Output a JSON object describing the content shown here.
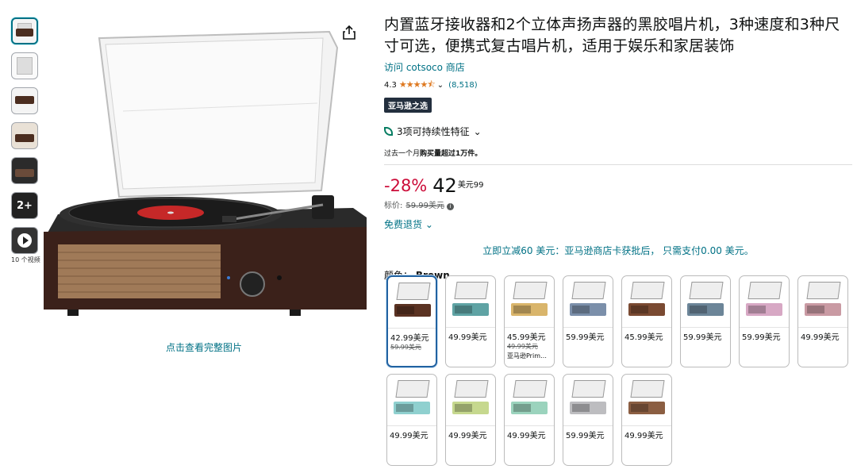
{
  "thumbnails": {
    "more_label": "2+",
    "video_label": "10 个视频"
  },
  "gallery": {
    "see_full_label": "点击查看完整图片"
  },
  "product": {
    "title": "内置蓝牙接收器和2个立体声扬声器的黑胶唱片机，3种速度和3种尺寸可选，便携式复古唱片机，适用于娱乐和家居装饰",
    "store_link": "访问 cotsoco 商店",
    "rating": "4.3",
    "stars": "★★★★⯪",
    "rating_count": "(8,518)",
    "badge": "亚马逊之选",
    "sustainability": "3项可持续性特征",
    "bought_prefix": "过去一个月",
    "bought_bold": "购买量超过1万件。"
  },
  "price": {
    "discount": "-28%",
    "whole": "42",
    "unit_fraction": "美元99",
    "list_label": "标价:",
    "list_price": "59.99美元",
    "returns": "免费退货",
    "promo": "立即立减60 美元：亚马逊商店卡获批后， 只需支付0.00 美元。"
  },
  "color": {
    "label": "颜色：",
    "selected": "Brown"
  },
  "swatches": [
    {
      "price": "42.99美元",
      "list": "59.99美元",
      "note": "",
      "body": "#5a3222"
    },
    {
      "price": "49.99美元",
      "list": "",
      "note": "",
      "body": "#5fa3a4"
    },
    {
      "price": "45.99美元",
      "list": "49.99美元",
      "note": "亚马逊Prim…",
      "body": "#d9b56b"
    },
    {
      "price": "59.99美元",
      "list": "",
      "note": "",
      "body": "#7b8faa"
    },
    {
      "price": "45.99美元",
      "list": "",
      "note": "",
      "body": "#7a4a32"
    },
    {
      "price": "59.99美元",
      "list": "",
      "note": "",
      "body": "#6c8598"
    },
    {
      "price": "59.99美元",
      "list": "",
      "note": "",
      "body": "#d7a8c4"
    },
    {
      "price": "49.99美元",
      "list": "",
      "note": "",
      "body": "#c99aa3"
    },
    {
      "price": "49.99美元",
      "list": "",
      "note": "",
      "body": "#8fd0cf"
    },
    {
      "price": "49.99美元",
      "list": "",
      "note": "",
      "body": "#c6d88e"
    },
    {
      "price": "49.99美元",
      "list": "",
      "note": "",
      "body": "#9bd3bd"
    },
    {
      "price": "59.99美元",
      "list": "",
      "note": "",
      "body": "#bdbdc0"
    },
    {
      "price": "49.99美元",
      "list": "",
      "note": "",
      "body": "#8b5e42"
    }
  ]
}
